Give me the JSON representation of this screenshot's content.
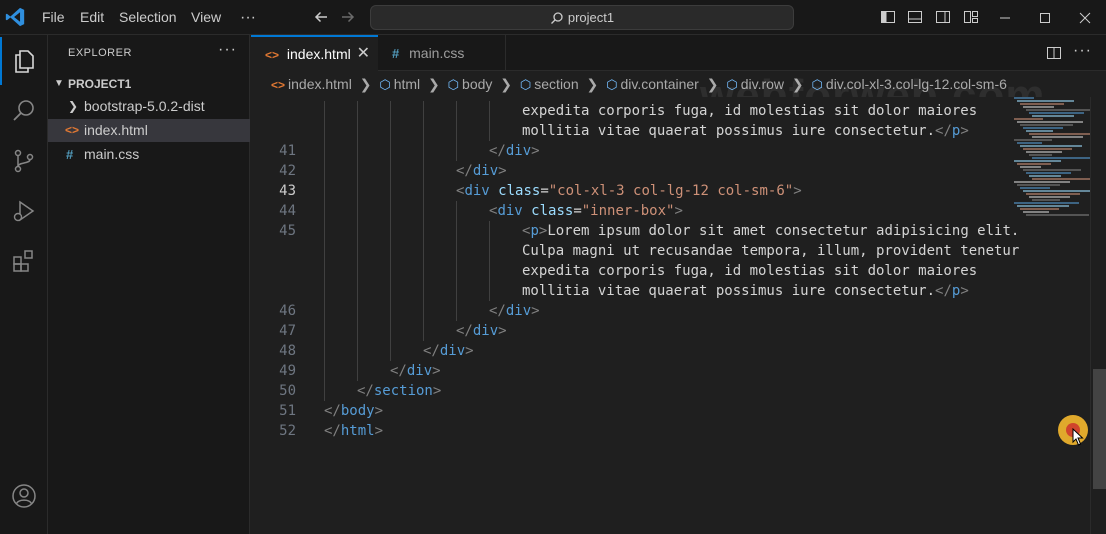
{
  "titlebar": {
    "menu": [
      "File",
      "Edit",
      "Selection",
      "View",
      "···"
    ],
    "search_text": "project1",
    "icons": [
      "vscode-logo-icon",
      "arrow-left-icon",
      "arrow-right-icon",
      "search-icon",
      "toggle-primary-sidebar-icon",
      "toggle-panel-icon",
      "toggle-secondary-sidebar-icon",
      "customize-layout-icon",
      "minimize-icon",
      "maximize-icon",
      "close-icon"
    ]
  },
  "activity_bar": {
    "items": [
      "explorer-icon",
      "search-icon",
      "source-control-icon",
      "run-debug-icon",
      "extensions-icon",
      "accounts-icon"
    ],
    "active": "explorer-icon"
  },
  "sidebar": {
    "title": "EXPLORER",
    "more": "···",
    "section": "PROJECT1",
    "items": [
      {
        "label": "bootstrap-5.0.2-dist",
        "kind": "folder"
      },
      {
        "label": "index.html",
        "kind": "html",
        "selected": true
      },
      {
        "label": "main.css",
        "kind": "css"
      }
    ]
  },
  "tabs": [
    {
      "label": "index.html",
      "active": true,
      "icon": "<>"
    },
    {
      "label": "main.css",
      "active": false,
      "icon": "#"
    }
  ],
  "breadcrumb": [
    "index.html",
    "html",
    "body",
    "section",
    "div.container",
    "div.row",
    "div.col-xl-3.col-lg-12.col-sm-6"
  ],
  "editor": {
    "current_line": "43",
    "lines": [
      {
        "n": "",
        "indent": 6,
        "text": "expedita corporis fuga, id molestias sit dolor maiores",
        "kind": "text"
      },
      {
        "n": "",
        "indent": 6,
        "text": "mollitia vitae quaerat possimus iure consectetur.",
        "kind": "text",
        "close": "</p>"
      },
      {
        "n": "41",
        "indent": 5,
        "kind": "close",
        "tag": "div"
      },
      {
        "n": "42",
        "indent": 4,
        "kind": "close",
        "tag": "div"
      },
      {
        "n": "43",
        "indent": 4,
        "kind": "open",
        "tag": "div",
        "attr": "class",
        "value": "\"col-xl-3 col-lg-12 col-sm-6\""
      },
      {
        "n": "44",
        "indent": 5,
        "kind": "open",
        "tag": "div",
        "attr": "class",
        "value": "\"inner-box\""
      },
      {
        "n": "45",
        "indent": 6,
        "text": "Lorem ipsum dolor sit amet consectetur adipisicing elit.",
        "kind": "ptext"
      },
      {
        "n": "",
        "indent": 6,
        "text": "Culpa magni ut recusandae tempora, illum, provident tenetur",
        "kind": "text"
      },
      {
        "n": "",
        "indent": 6,
        "text": "expedita corporis fuga, id molestias sit dolor maiores",
        "kind": "text"
      },
      {
        "n": "",
        "indent": 6,
        "text": "mollitia vitae quaerat possimus iure consectetur.",
        "kind": "text",
        "close": "</p>"
      },
      {
        "n": "46",
        "indent": 5,
        "kind": "close",
        "tag": "div"
      },
      {
        "n": "47",
        "indent": 4,
        "kind": "close",
        "tag": "div"
      },
      {
        "n": "48",
        "indent": 3,
        "kind": "close",
        "tag": "div"
      },
      {
        "n": "49",
        "indent": 2,
        "kind": "close",
        "tag": "div"
      },
      {
        "n": "50",
        "indent": 1,
        "kind": "close",
        "tag": "section"
      },
      {
        "n": "51",
        "indent": 0,
        "kind": "close",
        "tag": "body"
      },
      {
        "n": "52",
        "indent": 0,
        "kind": "close",
        "tag": "html"
      }
    ]
  },
  "watermark": "webforweb.com",
  "colors": {
    "accent": "#0078d4",
    "tag_name": "#569cd6",
    "attr": "#9cdcfe",
    "string": "#ce9178",
    "html_icon": "#e37933",
    "css_icon": "#519aba"
  }
}
